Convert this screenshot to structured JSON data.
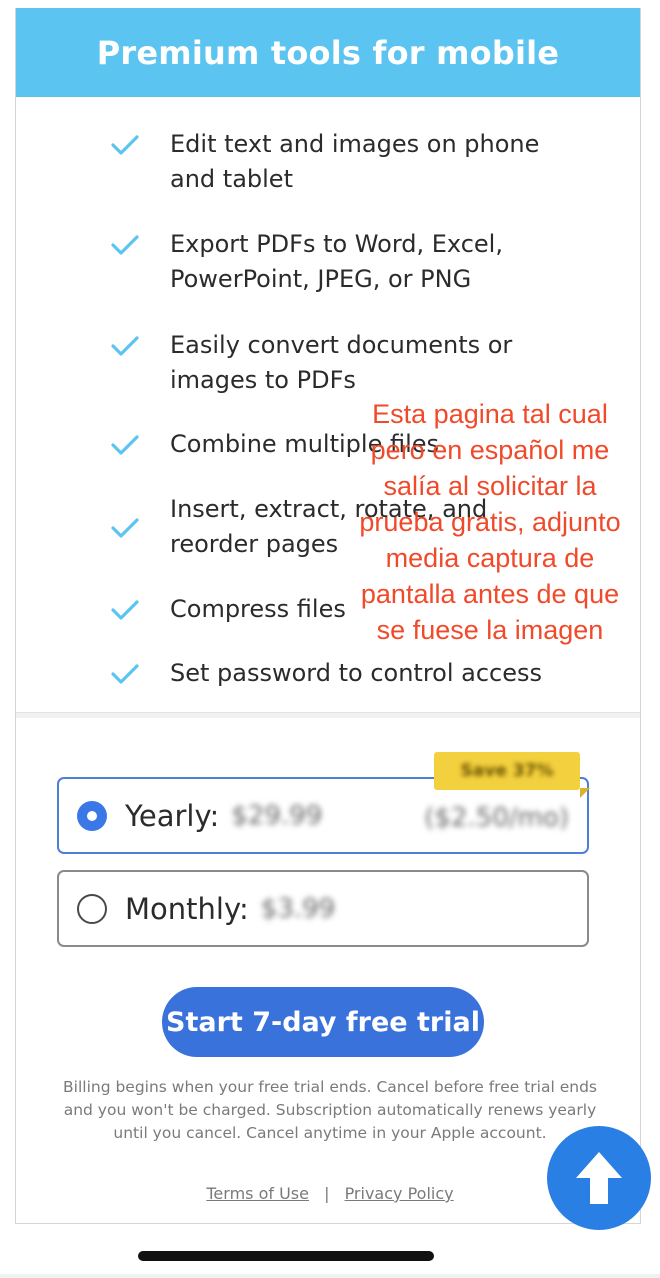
{
  "header": {
    "title": "Premium tools for mobile"
  },
  "features": [
    {
      "text": "Edit text and images on phone\nand tablet"
    },
    {
      "text": "Export PDFs to Word, Excel,\nPowerPoint, JPEG, or PNG"
    },
    {
      "text": "Easily convert documents or\nimages to PDFs"
    },
    {
      "text": "Combine multiple files"
    },
    {
      "text": "Insert, extract, rotate, and\nreorder pages"
    },
    {
      "text": "Compress files"
    },
    {
      "text": "Set password to control access"
    }
  ],
  "plans": {
    "yearly": {
      "label": "Yearly:",
      "price": "$29.99",
      "per_month": "($2.50/mo)",
      "selected": true,
      "badge": "Save 37%"
    },
    "monthly": {
      "label": "Monthly:",
      "price": "$3.99",
      "selected": false
    }
  },
  "cta": {
    "label": "Start 7-day free trial"
  },
  "billing_note": "Billing begins when your free trial ends. Cancel before free trial ends and you won't be charged. Subscription automatically renews yearly until you cancel. Cancel anytime in your Apple account.",
  "links": {
    "terms": "Terms of Use",
    "separator": "|",
    "privacy": "Privacy Policy"
  },
  "overlay_note": "Esta pagina tal cual\npero en español me\nsalía al solicitar la\nprueba gratis, adjunto\nmedia captura de\npantalla antes de que\nse fuese la imagen",
  "colors": {
    "header_bg": "#5bc4f0",
    "check": "#5bc4f0",
    "cta_bg": "#3a72dc",
    "selected_border": "#4d7fd6",
    "overlay_text": "#f04a2a",
    "fab_bg": "#2a7fe5"
  },
  "icons": {
    "feature": "checkmark-icon",
    "fab": "arrow-up-icon"
  }
}
